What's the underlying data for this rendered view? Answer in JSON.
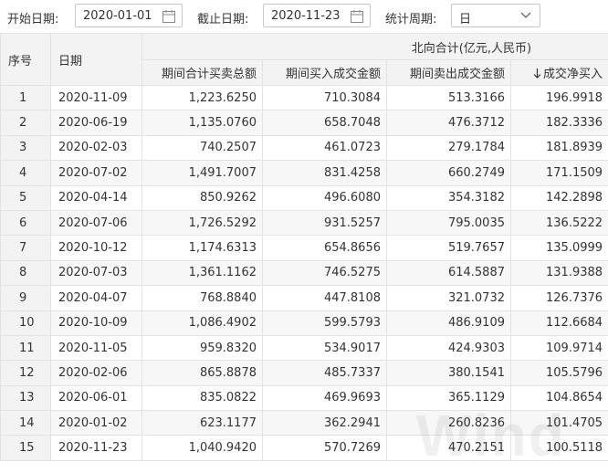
{
  "filters": {
    "start_label": "开始日期:",
    "start_value": "2020-01-01",
    "end_label": "截止日期:",
    "end_value": "2020-11-23",
    "period_label": "统计周期:",
    "period_value": "日",
    "calendar_icon": "calendar-icon",
    "dropdown_icon": "chevron-down-icon"
  },
  "table": {
    "header": {
      "col_id": "序号",
      "col_date": "日期",
      "group": "北向合计(亿元,人民币)",
      "total": "期间合计买卖总额",
      "buy": "期间买入成交金额",
      "sell": "期间卖出成交金额",
      "net": "成交净买入",
      "sort_icon": "sort-down-arrow-icon"
    },
    "rows": [
      {
        "id": "1",
        "date": "2020-11-09",
        "total": "1,223.6250",
        "buy": "710.3084",
        "sell": "513.3166",
        "net": "196.9918"
      },
      {
        "id": "2",
        "date": "2020-06-19",
        "total": "1,135.0760",
        "buy": "658.7048",
        "sell": "476.3712",
        "net": "182.3336"
      },
      {
        "id": "3",
        "date": "2020-02-03",
        "total": "740.2507",
        "buy": "461.0723",
        "sell": "279.1784",
        "net": "181.8939"
      },
      {
        "id": "4",
        "date": "2020-07-02",
        "total": "1,491.7007",
        "buy": "831.4258",
        "sell": "660.2749",
        "net": "171.1509"
      },
      {
        "id": "5",
        "date": "2020-04-14",
        "total": "850.9262",
        "buy": "496.6080",
        "sell": "354.3182",
        "net": "142.2898"
      },
      {
        "id": "6",
        "date": "2020-07-06",
        "total": "1,726.5292",
        "buy": "931.5257",
        "sell": "795.0035",
        "net": "136.5222"
      },
      {
        "id": "7",
        "date": "2020-10-12",
        "total": "1,174.6313",
        "buy": "654.8656",
        "sell": "519.7657",
        "net": "135.0999"
      },
      {
        "id": "8",
        "date": "2020-07-03",
        "total": "1,361.1162",
        "buy": "746.5275",
        "sell": "614.5887",
        "net": "131.9388"
      },
      {
        "id": "9",
        "date": "2020-04-07",
        "total": "768.8840",
        "buy": "447.8108",
        "sell": "321.0732",
        "net": "126.7376"
      },
      {
        "id": "10",
        "date": "2020-10-09",
        "total": "1,086.4902",
        "buy": "599.5793",
        "sell": "486.9109",
        "net": "112.6684"
      },
      {
        "id": "11",
        "date": "2020-11-05",
        "total": "959.8320",
        "buy": "534.9017",
        "sell": "424.9303",
        "net": "109.9714"
      },
      {
        "id": "12",
        "date": "2020-02-06",
        "total": "865.8878",
        "buy": "485.7337",
        "sell": "380.1541",
        "net": "105.5796"
      },
      {
        "id": "13",
        "date": "2020-06-01",
        "total": "835.0822",
        "buy": "469.9693",
        "sell": "365.1129",
        "net": "104.8654"
      },
      {
        "id": "14",
        "date": "2020-01-02",
        "total": "623.1177",
        "buy": "362.2941",
        "sell": "260.8236",
        "net": "101.4705"
      },
      {
        "id": "15",
        "date": "2020-11-23",
        "total": "1,040.9420",
        "buy": "570.7269",
        "sell": "470.2151",
        "net": "100.5118"
      }
    ]
  },
  "watermark": "Wind"
}
